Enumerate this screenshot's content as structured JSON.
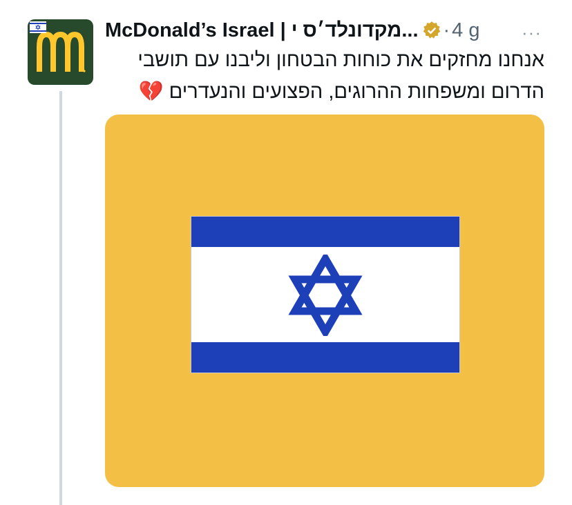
{
  "tweet": {
    "display_name": "McDonald’s Israel | מקדונלד׳ס י...",
    "separator": "·",
    "time": "4 g",
    "more_label": "···",
    "text": "אנחנו מחזקים את כוחות הבטחון וליבנו עם תושבי הדרום ומשפחות ההרוגים, הפצועים והנעדרים 💔"
  },
  "icons": {
    "avatar_logo": "mcdonalds-arches-logo",
    "avatar_badge": "israel-flag-icon",
    "verified": "verified-badge-icon",
    "more": "more-icon"
  },
  "colors": {
    "avatar_bg": "#264a2b",
    "arches": "#ffc72c",
    "media_bg": "#f3bf45",
    "flag_blue": "#1d3fb8",
    "verified_gold": "#d4a72c"
  }
}
